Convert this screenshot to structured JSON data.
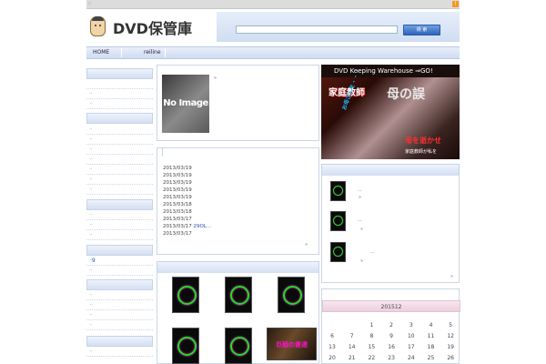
{
  "topbar": {
    "text": "::",
    "rss_icon": "rss-icon"
  },
  "header": {
    "logo_text": "DVD保管庫",
    "search_placeholder": "",
    "search_button": "検 索"
  },
  "nav": {
    "items": [
      "HOME",
      "reiline"
    ]
  },
  "left": {
    "group1": [
      "",
      "·",
      "·",
      "·"
    ],
    "group2": [
      "·",
      "·",
      "·",
      "·",
      "·",
      "·",
      "·"
    ],
    "group3": [
      "·",
      "·",
      "·"
    ],
    "group4": [
      "·9",
      "·"
    ],
    "group5": [
      "·",
      "·",
      "·",
      "·"
    ],
    "group6": [
      "·"
    ]
  },
  "center": {
    "noimage_label": "No Image",
    "quote_mark": "»",
    "dates": [
      {
        "date": "2013/03/19",
        "link": ""
      },
      {
        "date": "2013/03/19",
        "link": ""
      },
      {
        "date": "2013/03/19",
        "link": ""
      },
      {
        "date": "2013/03/19",
        "link": ""
      },
      {
        "date": "2013/03/19",
        "link": ""
      },
      {
        "date": "2013/03/18",
        "link": ""
      },
      {
        "date": "2013/03/18",
        "link": ""
      },
      {
        "date": "2013/03/17",
        "link": ""
      },
      {
        "date": "2013/03/17",
        "link": "29OL..."
      },
      {
        "date": "2013/03/17",
        "link": ""
      }
    ],
    "more_mark": "»",
    "dvd_title": "巨顔の妻達"
  },
  "right": {
    "banner_top": "DVD Keeping Warehouse ⇒GO!",
    "banner_t1": "家庭教師",
    "banner_t2": "母の誤",
    "banner_t3": "母を逝かせ",
    "banner_t4": "家庭教師が私を",
    "banner_t5": "お母さんを・・・",
    "items": [
      {
        "dots": "...",
        "mark": "»"
      },
      {
        "dots": "...",
        "mark": "»"
      },
      {
        "dots": "...",
        "mark": "»"
      }
    ],
    "more_mark": "»",
    "calendar": {
      "title": "201512",
      "rows": [
        [
          "",
          "",
          "1",
          "2",
          "3",
          "4",
          "5"
        ],
        [
          "6",
          "7",
          "8",
          "9",
          "10",
          "11",
          "12"
        ],
        [
          "13",
          "14",
          "15",
          "16",
          "17",
          "18",
          "19"
        ],
        [
          "20",
          "21",
          "22",
          "23",
          "24",
          "25",
          "26"
        ]
      ]
    }
  }
}
